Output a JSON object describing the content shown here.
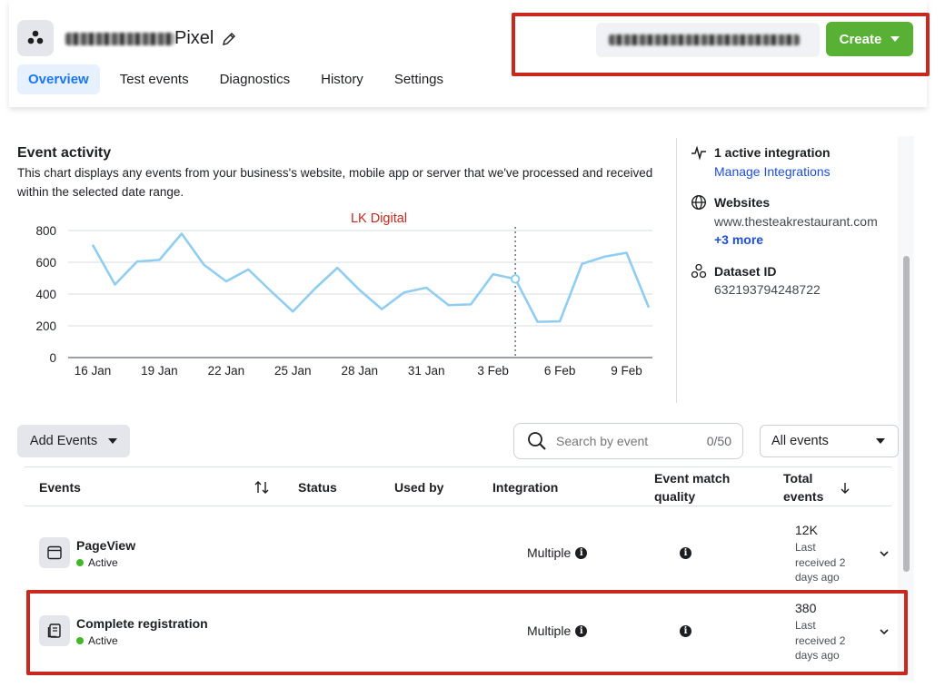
{
  "header": {
    "pixel_name_suffix": "Pixel",
    "tabs": [
      {
        "label": "Overview",
        "active": true
      },
      {
        "label": "Test events",
        "active": false
      },
      {
        "label": "Diagnostics",
        "active": false
      },
      {
        "label": "History",
        "active": false
      },
      {
        "label": "Settings",
        "active": false
      }
    ],
    "create_label": "Create",
    "accent_color": "#58b135"
  },
  "activity": {
    "title": "Event activity",
    "description": "This chart displays any events from your business's website, mobile app or server that we've processed and received within the selected date range."
  },
  "chart_data": {
    "type": "line",
    "title": "LK Digital",
    "xlabel": "",
    "ylabel": "",
    "ylim": [
      0,
      800
    ],
    "yticks": [
      0,
      200,
      400,
      600,
      800
    ],
    "xticks": [
      "16 Jan",
      "19 Jan",
      "22 Jan",
      "25 Jan",
      "28 Jan",
      "31 Jan",
      "3 Feb",
      "6 Feb",
      "9 Feb"
    ],
    "grid": true,
    "series": [
      {
        "color": "#8fcdf1",
        "values": [
          710,
          460,
          605,
          615,
          780,
          585,
          480,
          555,
          420,
          290,
          435,
          565,
          425,
          305,
          410,
          440,
          330,
          335,
          525,
          495,
          225,
          228,
          590,
          635,
          660,
          315
        ]
      }
    ],
    "hover_index": 19
  },
  "side": {
    "integration_label": "1 active integration",
    "manage_label": "Manage Integrations",
    "websites_label": "Websites",
    "website": "www.thesteakrestaurant.com",
    "more_label": "+3 more",
    "dataset_label": "Dataset ID",
    "dataset_id": "632193794248722"
  },
  "controls": {
    "add_events_label": "Add Events",
    "search_placeholder": "Search by event",
    "search_count": "0/50",
    "filter_label": "All events"
  },
  "table": {
    "headers": {
      "events": "Events",
      "status": "Status",
      "used_by": "Used by",
      "integration": "Integration",
      "emq_1": "Event match",
      "emq_2": "quality",
      "total_1": "Total",
      "total_2": "events"
    },
    "rows": [
      {
        "name": "PageView",
        "status": "Active",
        "integration": "Multiple",
        "total": "12K",
        "last_1": "Last",
        "last_2": "received 2",
        "last_3": "days ago"
      },
      {
        "name": "Complete registration",
        "status": "Active",
        "integration": "Multiple",
        "total": "380",
        "last_1": "Last",
        "last_2": "received 2",
        "last_3": "days ago"
      }
    ]
  }
}
